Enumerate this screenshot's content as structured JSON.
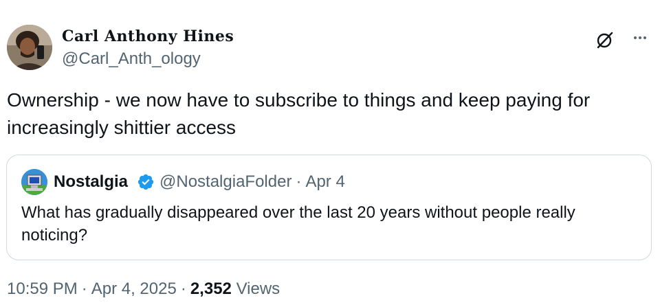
{
  "author": {
    "display_name": "Carl Anthony Hines",
    "handle": "@Carl_Anth_ology"
  },
  "actions": {
    "grok_icon": "grok-icon",
    "more_icon": "more-icon"
  },
  "tweet": {
    "text": "Ownership - we now have to subscribe to things and keep paying for increasingly shittier access"
  },
  "quote": {
    "display_name": "Nostalgia",
    "verified": true,
    "handle": "@NostalgiaFolder",
    "separator": "·",
    "date": "Apr 4",
    "text": "What has gradually disappeared over the last 20 years without people really noticing?"
  },
  "footer": {
    "time": "10:59 PM",
    "separator": "·",
    "date": "Apr 4, 2025",
    "views_count": "2,352",
    "views_label": "Views"
  },
  "colors": {
    "text_primary": "#0f1419",
    "text_secondary": "#536471",
    "border": "#cfd9de",
    "verified": "#1d9bf0"
  }
}
